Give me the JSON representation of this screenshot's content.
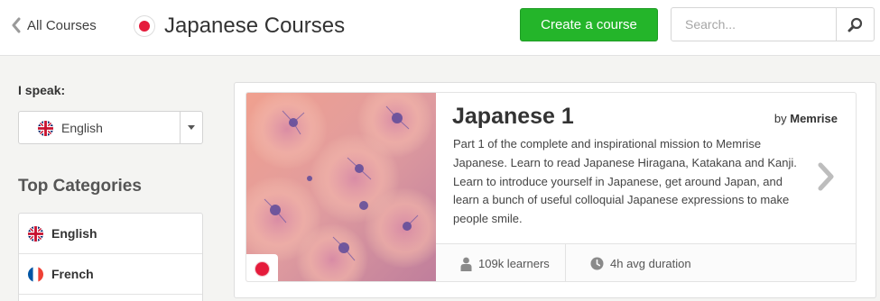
{
  "header": {
    "back_label": "All Courses",
    "title": "Japanese Courses",
    "create_button": "Create a course",
    "search_placeholder": "Search..."
  },
  "sidebar": {
    "speak_label": "I speak:",
    "selected_language": "English",
    "categories_title": "Top Categories",
    "categories": [
      {
        "label": "English",
        "flag": "uk-flag-icon"
      },
      {
        "label": "French",
        "flag": "france-flag-icon"
      }
    ]
  },
  "course": {
    "title": "Japanese 1",
    "author_prefix": "by",
    "author": "Memrise",
    "description": "Part 1 of the complete and inspirational mission to Memrise Japanese. Learn to read Japanese Hiragana, Katakana and Kanji. Learn to introduce yourself in Japanese, get around Japan, and learn a bunch of useful colloquial Japanese expressions to make people smile.",
    "learners": "109k learners",
    "duration": "4h avg duration"
  },
  "colors": {
    "brand_green": "#24b52a",
    "japan_red": "#e51b3b"
  }
}
